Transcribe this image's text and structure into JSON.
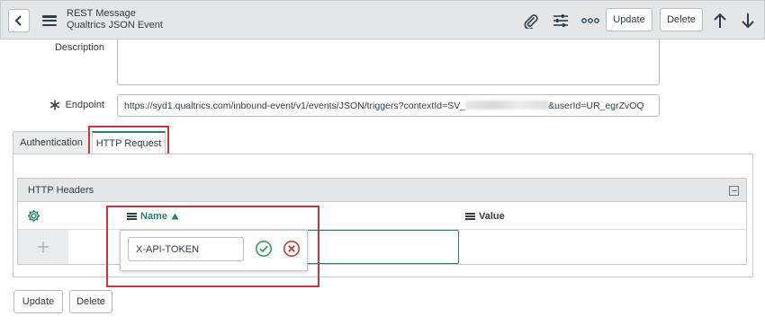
{
  "header": {
    "record_type": "REST Message",
    "record_name": "Qualtrics JSON Event",
    "update_label": "Update",
    "delete_label": "Delete"
  },
  "form": {
    "description_label": "Description",
    "endpoint_label": "Endpoint",
    "endpoint_value_prefix": "https://syd1.qualtrics.com/inbound-event/v1/events/JSON/triggers?contextId=SV_",
    "endpoint_value_suffix": "&userId=UR_egrZvOQ"
  },
  "tabs": [
    {
      "label": "Authentication",
      "active": false
    },
    {
      "label": "HTTP Request",
      "active": true
    }
  ],
  "http_headers": {
    "section_title": "HTTP Headers",
    "columns": [
      {
        "label": "Name",
        "sorted": "ascending"
      },
      {
        "label": "Value"
      }
    ],
    "editing_value": "X-API-TOKEN"
  },
  "footer": {
    "update_label": "Update",
    "delete_label": "Delete"
  },
  "colors": {
    "accent_green": "#2e7d6b",
    "highlight_red": "#c0393f",
    "header_bg": "#e4e6e7"
  }
}
